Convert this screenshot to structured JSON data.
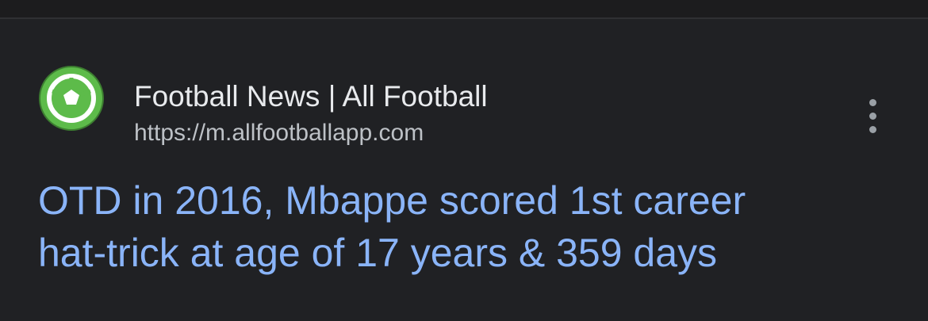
{
  "source": {
    "site_name": "Football News | All Football",
    "url": "https://m.allfootballapp.com",
    "favicon_icon": "soccer-ball-icon",
    "favicon_color": "#5dbb4a"
  },
  "result": {
    "headline_line1": "OTD in 2016, Mbappe scored 1st career",
    "headline_line2": "hat-trick at age of 17 years & 359 days",
    "link_color": "#8ab4f8"
  },
  "menu": {
    "icon": "more-vert-icon"
  },
  "colors": {
    "background": "#202124",
    "title_text": "#e8eaed",
    "url_text": "#bdc1c6"
  }
}
